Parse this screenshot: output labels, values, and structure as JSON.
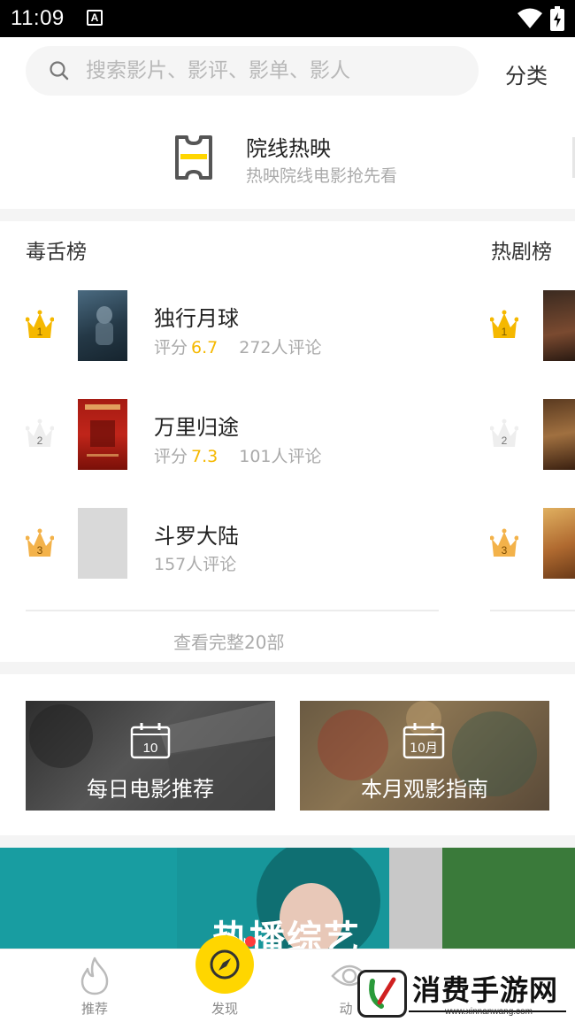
{
  "status_bar": {
    "time": "11:09",
    "notification_letter": "A"
  },
  "search": {
    "placeholder": "搜索影片、影评、影单、影人",
    "category_label": "分类"
  },
  "cinema": {
    "title": "院线热映",
    "subtitle": "热映院线电影抢先看"
  },
  "rankings": {
    "left": {
      "title": "毒舌榜",
      "items": [
        {
          "rank": "1",
          "title": "独行月球",
          "score_label": "评分",
          "score": "6.7",
          "reviews": "272人评论"
        },
        {
          "rank": "2",
          "title": "万里归途",
          "score_label": "评分",
          "score": "7.3",
          "reviews": "101人评论"
        },
        {
          "rank": "3",
          "title": "斗罗大陆",
          "reviews": "157人评论"
        }
      ],
      "view_all": "查看完整20部"
    },
    "right": {
      "title": "热剧榜",
      "ranks": [
        "1",
        "2",
        "3"
      ]
    }
  },
  "features": [
    {
      "label": "每日电影推荐",
      "calendar_text": "10"
    },
    {
      "label": "本月观影指南",
      "calendar_text": "10月"
    }
  ],
  "variety_banner": {
    "title": "热播综艺"
  },
  "bottom_nav": [
    {
      "label": "推荐",
      "icon": "flame-icon"
    },
    {
      "label": "发现",
      "icon": "compass-icon"
    },
    {
      "label": "动",
      "icon": "eye-icon"
    }
  ],
  "watermark": {
    "text": "消费手游网",
    "url": "www.xinnanwang.com"
  },
  "colors": {
    "accent": "#ffd600",
    "score": "#f5b800",
    "crown_gold": "#f5b800",
    "banner_teal": "#17969a"
  }
}
